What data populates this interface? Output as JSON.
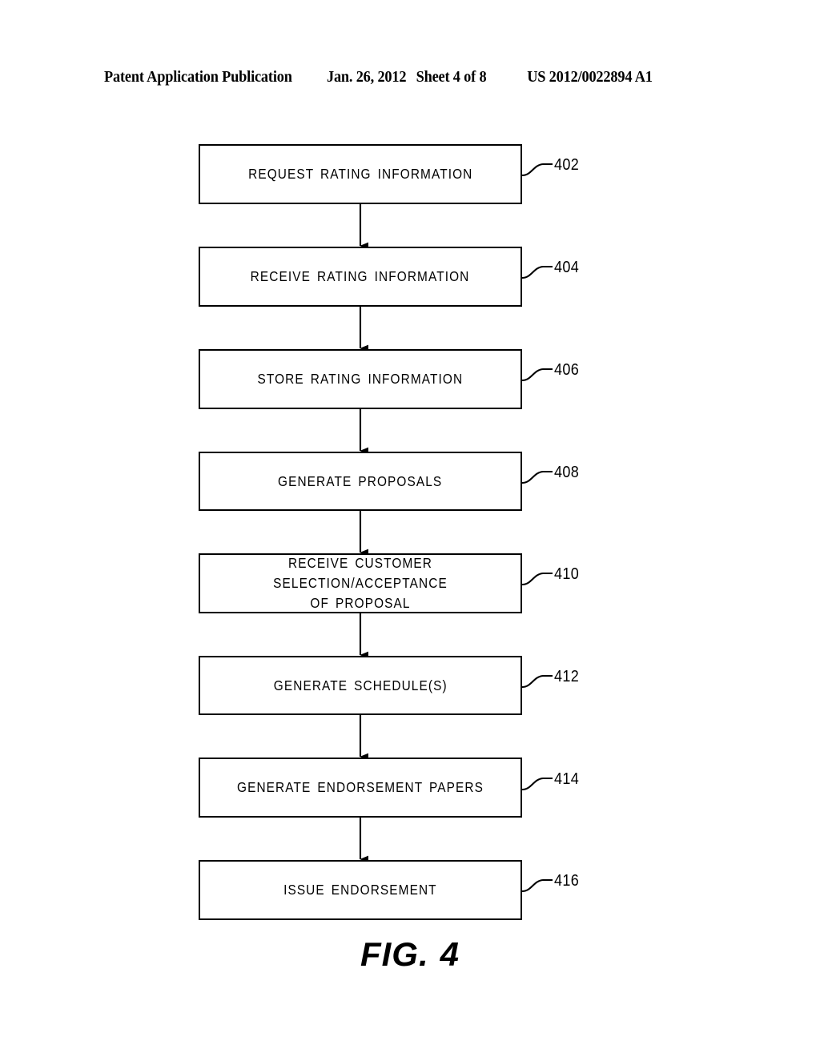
{
  "header": {
    "publication": "Patent Application Publication",
    "date": "Jan. 26, 2012",
    "sheet": "Sheet 4 of 8",
    "document_number": "US 2012/0022894 A1"
  },
  "figure": {
    "caption_prefix": "FIG.",
    "caption_number": "4",
    "type": "flowchart",
    "orientation": "top-to-bottom",
    "connector": "arrow",
    "line_color": "#000000",
    "fill_color": "#ffffff"
  },
  "flowchart": {
    "nodes": [
      {
        "ref": "402",
        "label": "REQUEST RATING INFORMATION"
      },
      {
        "ref": "404",
        "label": "RECEIVE RATING INFORMATION"
      },
      {
        "ref": "406",
        "label": "STORE RATING INFORMATION"
      },
      {
        "ref": "408",
        "label": "GENERATE PROPOSALS"
      },
      {
        "ref": "410",
        "label": "RECEIVE CUSTOMER SELECTION/ACCEPTANCE\nOF PROPOSAL"
      },
      {
        "ref": "412",
        "label": "GENERATE SCHEDULE(S)"
      },
      {
        "ref": "414",
        "label": "GENERATE ENDORSEMENT PAPERS"
      },
      {
        "ref": "416",
        "label": "ISSUE ENDORSEMENT"
      }
    ]
  }
}
